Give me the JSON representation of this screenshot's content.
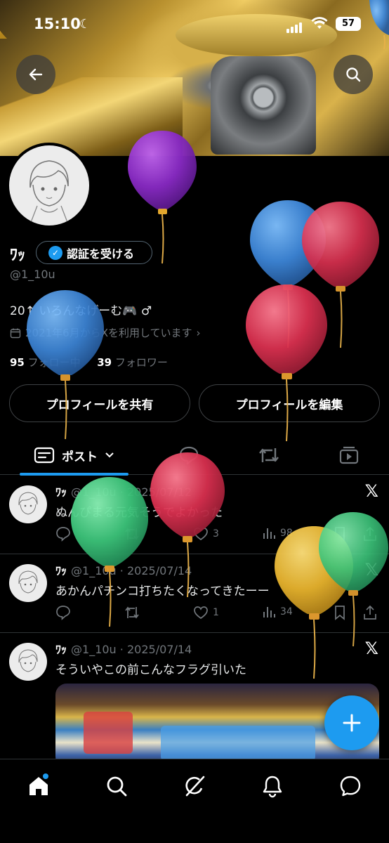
{
  "status_bar": {
    "time": "15:10",
    "battery": "57"
  },
  "profile": {
    "name": "ﾜｯ",
    "verify_label": "認証を受ける",
    "handle": "@1_10u",
    "bio": "20↑ いろんなげーむ🎮 ♂",
    "joined": "2021年6月からXを利用しています",
    "following_count": "95",
    "following_label": "フォロー中",
    "followers_count": "39",
    "followers_label": "フォロワー",
    "share_label": "プロフィールを共有",
    "edit_label": "プロフィールを編集"
  },
  "tabs": {
    "posts_label": "ポスト"
  },
  "posts": [
    {
      "name": "ﾜｯ",
      "handle": "@1_10u",
      "date": "2025/07/12",
      "text": "ぬんぴまる元気そうでよかった",
      "likes": "3",
      "views": "98"
    },
    {
      "name": "ﾜｯ",
      "handle": "@1_10u",
      "date": "2025/07/14",
      "text": "あかんパチンコ打ちたくなってきたーー",
      "likes": "1",
      "views": "34"
    },
    {
      "name": "ﾜｯ",
      "handle": "@1_10u",
      "date": "2025/07/14",
      "text": "そういやこの前こんなフラグ引いた"
    }
  ],
  "icons": {
    "status": [
      "moon-icon",
      "signal-icon",
      "wifi-icon",
      "battery-icon"
    ],
    "header": [
      "back-arrow-icon",
      "search-icon"
    ],
    "tabs": [
      "posts-icon",
      "chevron-down-icon",
      "reply-tab-icon",
      "repost-tab-icon",
      "media-tab-icon"
    ],
    "post_actions": [
      "reply-icon",
      "repost-icon",
      "like-icon",
      "views-icon",
      "bookmark-icon",
      "share-icon"
    ],
    "bottom_nav": [
      "home-icon",
      "search-icon",
      "grok-icon",
      "notifications-icon",
      "messages-icon"
    ]
  },
  "colors": {
    "accent": "#1d9bf0",
    "background": "#000000",
    "muted": "#71767b",
    "divider": "#2f3336"
  }
}
